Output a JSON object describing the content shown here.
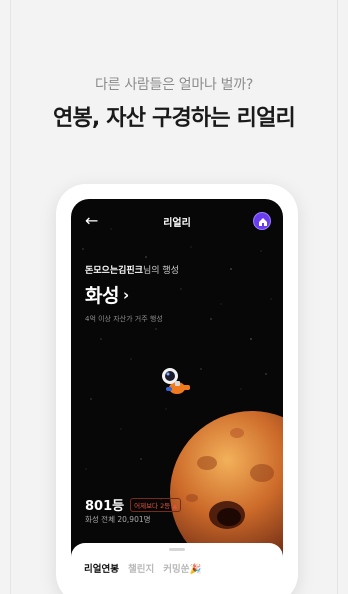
{
  "promo": {
    "subtitle": "다른 사람들은 얼마나 벌까?",
    "headline": "연봉, 자산 구경하는 리얼리"
  },
  "app": {
    "back_icon": "arrow-left-icon",
    "title": "리얼리",
    "avatar_icon": "house-avatar-icon",
    "accent_color": "#6a3cf0"
  },
  "planet": {
    "user_name": "돈모으는김핀크",
    "suffix": "님의 행성",
    "name": "화성",
    "chevron": "›",
    "note": "4억 이상 자산가 거주 행성"
  },
  "ranking": {
    "rank": "801등",
    "change": "어제보다 2등 ▲",
    "total": "화성 전체 20,901명"
  },
  "tabs": [
    {
      "label": "리얼연봉"
    },
    {
      "label": "챌린지"
    },
    {
      "label": "커밍쑨🎉"
    }
  ]
}
